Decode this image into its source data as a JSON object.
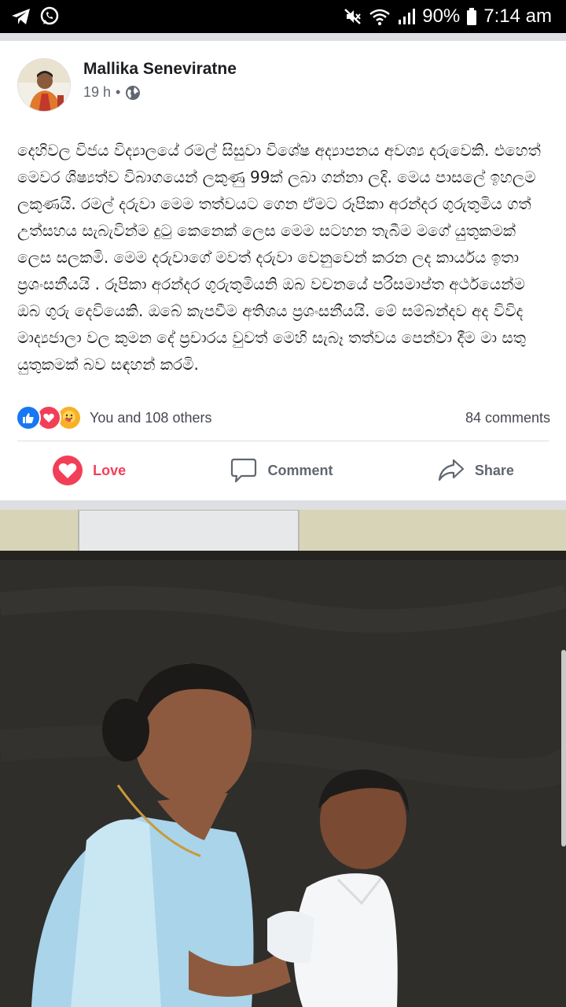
{
  "status_bar": {
    "battery": "90%",
    "time": "7:14 am",
    "icons": [
      "telegram-icon",
      "whatsapp-icon",
      "mute-icon",
      "wifi-icon",
      "signal-icon",
      "battery-icon"
    ]
  },
  "post": {
    "author": "Mallika Seneviratne",
    "time": "19 h",
    "privacy_icon": "globe-icon",
    "text": "දෙහිවල විජය විද්‍යාලයේ රමල් සිසුවා විශේෂ අද්‍යාපනය අවශ්‍ය දරුවෙකි. එහෙත් මෙවර ශිෂ්‍යත්ව විබාගයෙන් ලකුණු 99ක් ලබා ගන්නා ලදි. මෙය පාසලේ ඉහලම ලකුණයි. රමල් දරුවා මෙම තත්වයට ගෙන ඒමට රූපිකා අරන්දර ගුරුතුමිය ගත් උත්සහය සැබැවින්ම දුටු කෙනෙක් ලෙස මෙම සටහන තැබීම මගේ යුතුකමක් ලෙස සලකමි. මෙම දරුවාගේ මවත් දරුවා වෙනුවෙන් කරන ලද කාර්යය ඉතා ප්‍රශංසනීයයි . රූපිකා අරන්දර ගුරුතුමියනි ඔබ වචනයේ පරිසමාප්ත අර්ථයෙන්ම ඔබ ගුරු දෙවියෙකි. ඔබේ කැපවීම අතිශය ප්‍රශංසනීයයි. මේ සම්බන්දව අද විවිද මාද්‍යජාලා වල කුමන දේ ප්‍රචාරය වුවත් මෙහි සැබෑ තත්වය පෙන්වා දීම මා සතු යුතුකමක් බව සඳහන් කරමි.",
    "reactions": {
      "summary": "You and 108 others",
      "comments": "84 comments",
      "types": [
        "like",
        "love",
        "care"
      ]
    },
    "actions": {
      "love": "Love",
      "comment": "Comment",
      "share": "Share"
    }
  },
  "colors": {
    "status_bar": "#000000",
    "love_red": "#f33e58",
    "like_blue": "#1877f2",
    "care_yellow": "#f7b125",
    "meta_gray": "#606770",
    "feed_gray": "#dddfe2"
  }
}
